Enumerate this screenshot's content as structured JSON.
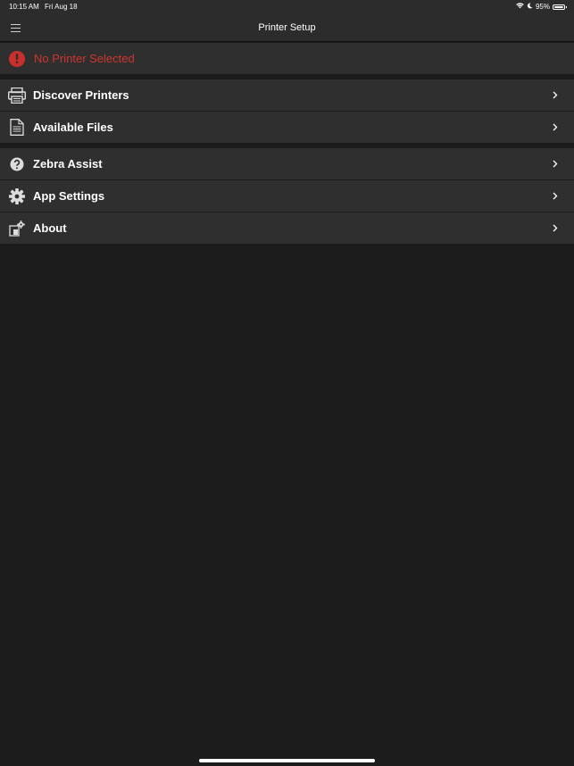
{
  "status_bar": {
    "time": "10:15 AM",
    "date": "Fri Aug 18",
    "battery_percent": "95%",
    "battery_level": 0.95,
    "icons": [
      "wifi-icon",
      "moon-icon",
      "battery-icon"
    ]
  },
  "nav": {
    "title": "Printer Setup",
    "menu_icon": "hamburger-menu-icon"
  },
  "alert": {
    "text": "No Printer Selected",
    "icon": "exclamation-icon",
    "color": "#d0352f"
  },
  "groups": [
    {
      "items": [
        {
          "label": "Discover Printers",
          "icon": "printer-icon"
        },
        {
          "label": "Available Files",
          "icon": "document-icon"
        }
      ]
    },
    {
      "items": [
        {
          "label": "Zebra Assist",
          "icon": "help-icon"
        },
        {
          "label": "App Settings",
          "icon": "gear-icon"
        },
        {
          "label": "About",
          "icon": "about-icon"
        }
      ]
    }
  ],
  "colors": {
    "background": "#1c1c1c",
    "bar": "#2c2c2c",
    "row": "#2f2f2f",
    "alert": "#d0352f"
  }
}
